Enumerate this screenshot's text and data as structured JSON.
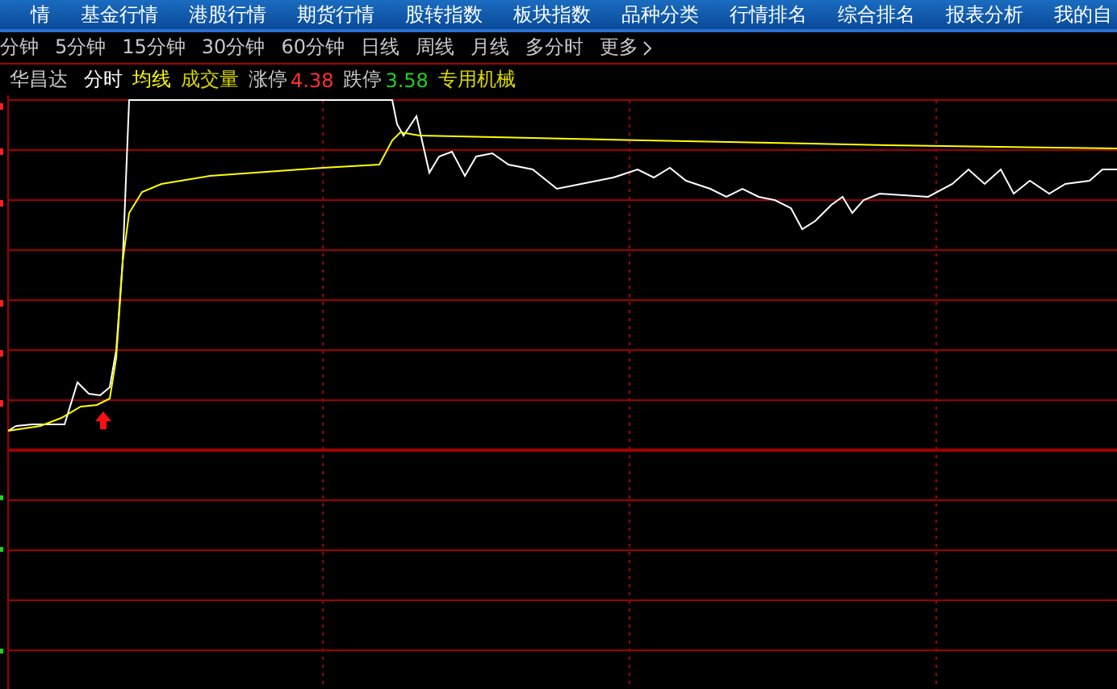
{
  "nav_tabs": [
    {
      "label": "情"
    },
    {
      "label": "基金行情"
    },
    {
      "label": "港股行情"
    },
    {
      "label": "期货行情"
    },
    {
      "label": "股转指数"
    },
    {
      "label": "板块指数"
    },
    {
      "label": "品种分类"
    },
    {
      "label": "行情排名"
    },
    {
      "label": "综合排名"
    },
    {
      "label": "报表分析"
    },
    {
      "label": "我的自"
    }
  ],
  "periods": [
    {
      "label": "分钟"
    },
    {
      "label": "5分钟"
    },
    {
      "label": "15分钟"
    },
    {
      "label": "30分钟"
    },
    {
      "label": "60分钟"
    },
    {
      "label": "日线"
    },
    {
      "label": "周线"
    },
    {
      "label": "月线"
    },
    {
      "label": "多分时"
    },
    {
      "label": "更多"
    }
  ],
  "info": {
    "stock_name": "华昌达",
    "indicators": [
      {
        "label": "分时",
        "color": "#ffffff"
      },
      {
        "label": "均线",
        "color": "#ffff00"
      },
      {
        "label": "成交量",
        "color": "#d8d800"
      }
    ],
    "limits": [
      {
        "kind": "up",
        "label": "涨停",
        "value": "4.38"
      },
      {
        "kind": "down",
        "label": "跌停",
        "value": "3.58"
      }
    ],
    "industry": "专用机械"
  }
}
